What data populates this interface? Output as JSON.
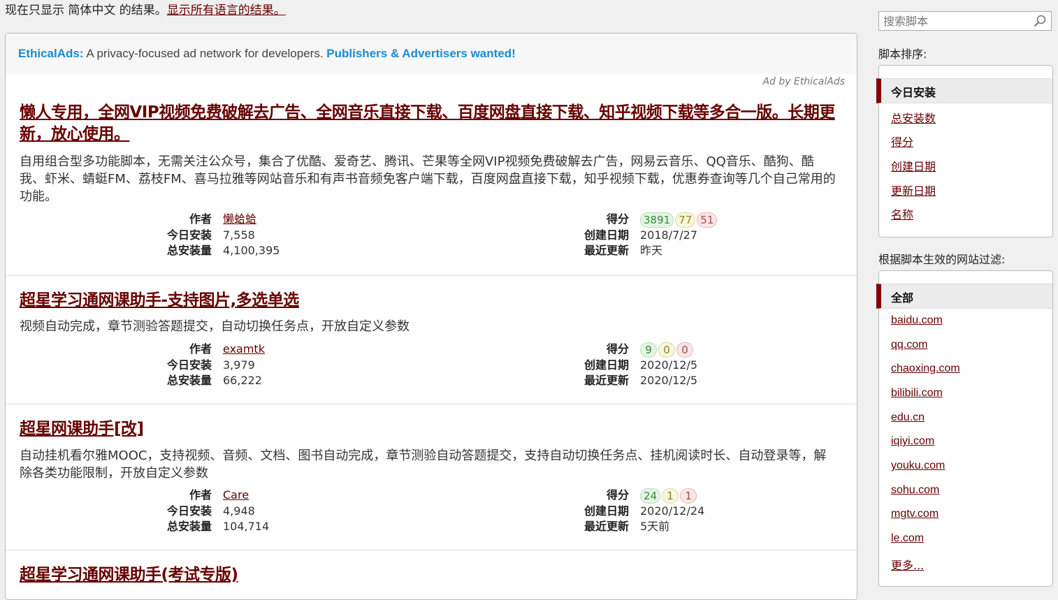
{
  "lang_notice": {
    "text": "现在只显示 简体中文 的结果。",
    "link": "显示所有语言的结果。"
  },
  "ad": {
    "brand": "EthicalAds:",
    "text": "A privacy-focused ad network for developers.",
    "cta": "Publishers & Advertisers wanted!",
    "by": "Ad by EthicalAds"
  },
  "labels": {
    "author": "作者",
    "daily": "今日安装",
    "total": "总安装量",
    "rating": "得分",
    "created": "创建日期",
    "updated": "最近更新"
  },
  "scripts": [
    {
      "title": "懒人专用，全网VIP视频免费破解去广告、全网音乐直接下载、百度网盘直接下载、知乎视频下载等多合一版。长期更新，放心使用。",
      "desc": "自用组合型多功能脚本，无需关注公众号，集合了优酷、爱奇艺、腾讯、芒果等全网VIP视频免费破解去广告，网易云音乐、QQ音乐、酷狗、酷我、虾米、蜻蜓FM、荔枝FM、喜马拉雅等网站音乐和有声书音频免客户端下载，百度网盘直接下载，知乎视频下载，优惠券查询等几个自己常用的功能。",
      "author": "懒蛤蛤",
      "daily": "7,558",
      "total": "4,100,395",
      "good": "3891",
      "ok": "77",
      "bad": "51",
      "created": "2018/7/27",
      "updated": "昨天"
    },
    {
      "title": "超星学习通网课助手-支持图片,多选单选",
      "desc": "视频自动完成，章节测验答题提交，自动切换任务点，开放自定义参数",
      "author": "examtk",
      "daily": "3,979",
      "total": "66,222",
      "good": "9",
      "ok": "0",
      "bad": "0",
      "created": "2020/12/5",
      "updated": "2020/12/5"
    },
    {
      "title": "超星网课助手[改]",
      "desc": "自动挂机看尔雅MOOC，支持视频、音频、文档、图书自动完成，章节测验自动答题提交，支持自动切换任务点、挂机阅读时长、自动登录等，解除各类功能限制，开放自定义参数",
      "author": "Care",
      "daily": "4,948",
      "total": "104,714",
      "good": "24",
      "ok": "1",
      "bad": "1",
      "created": "2020/12/24",
      "updated": "5天前"
    },
    {
      "title": "超星学习通网课助手(考试专版)"
    }
  ],
  "sidebar": {
    "search_placeholder": "搜索脚本",
    "sort_label": "脚本排序:",
    "sort_current": "今日安装",
    "sort_items": [
      "总安装数",
      "得分",
      "创建日期",
      "更新日期",
      "名称"
    ],
    "filter_label": "根据脚本生效的网站过滤:",
    "filter_current": "全部",
    "filter_items": [
      "baidu.com",
      "qq.com",
      "chaoxing.com",
      "bilibili.com",
      "edu.cn",
      "iqiyi.com",
      "youku.com",
      "sohu.com",
      "mgtv.com",
      "le.com",
      "更多..."
    ]
  }
}
